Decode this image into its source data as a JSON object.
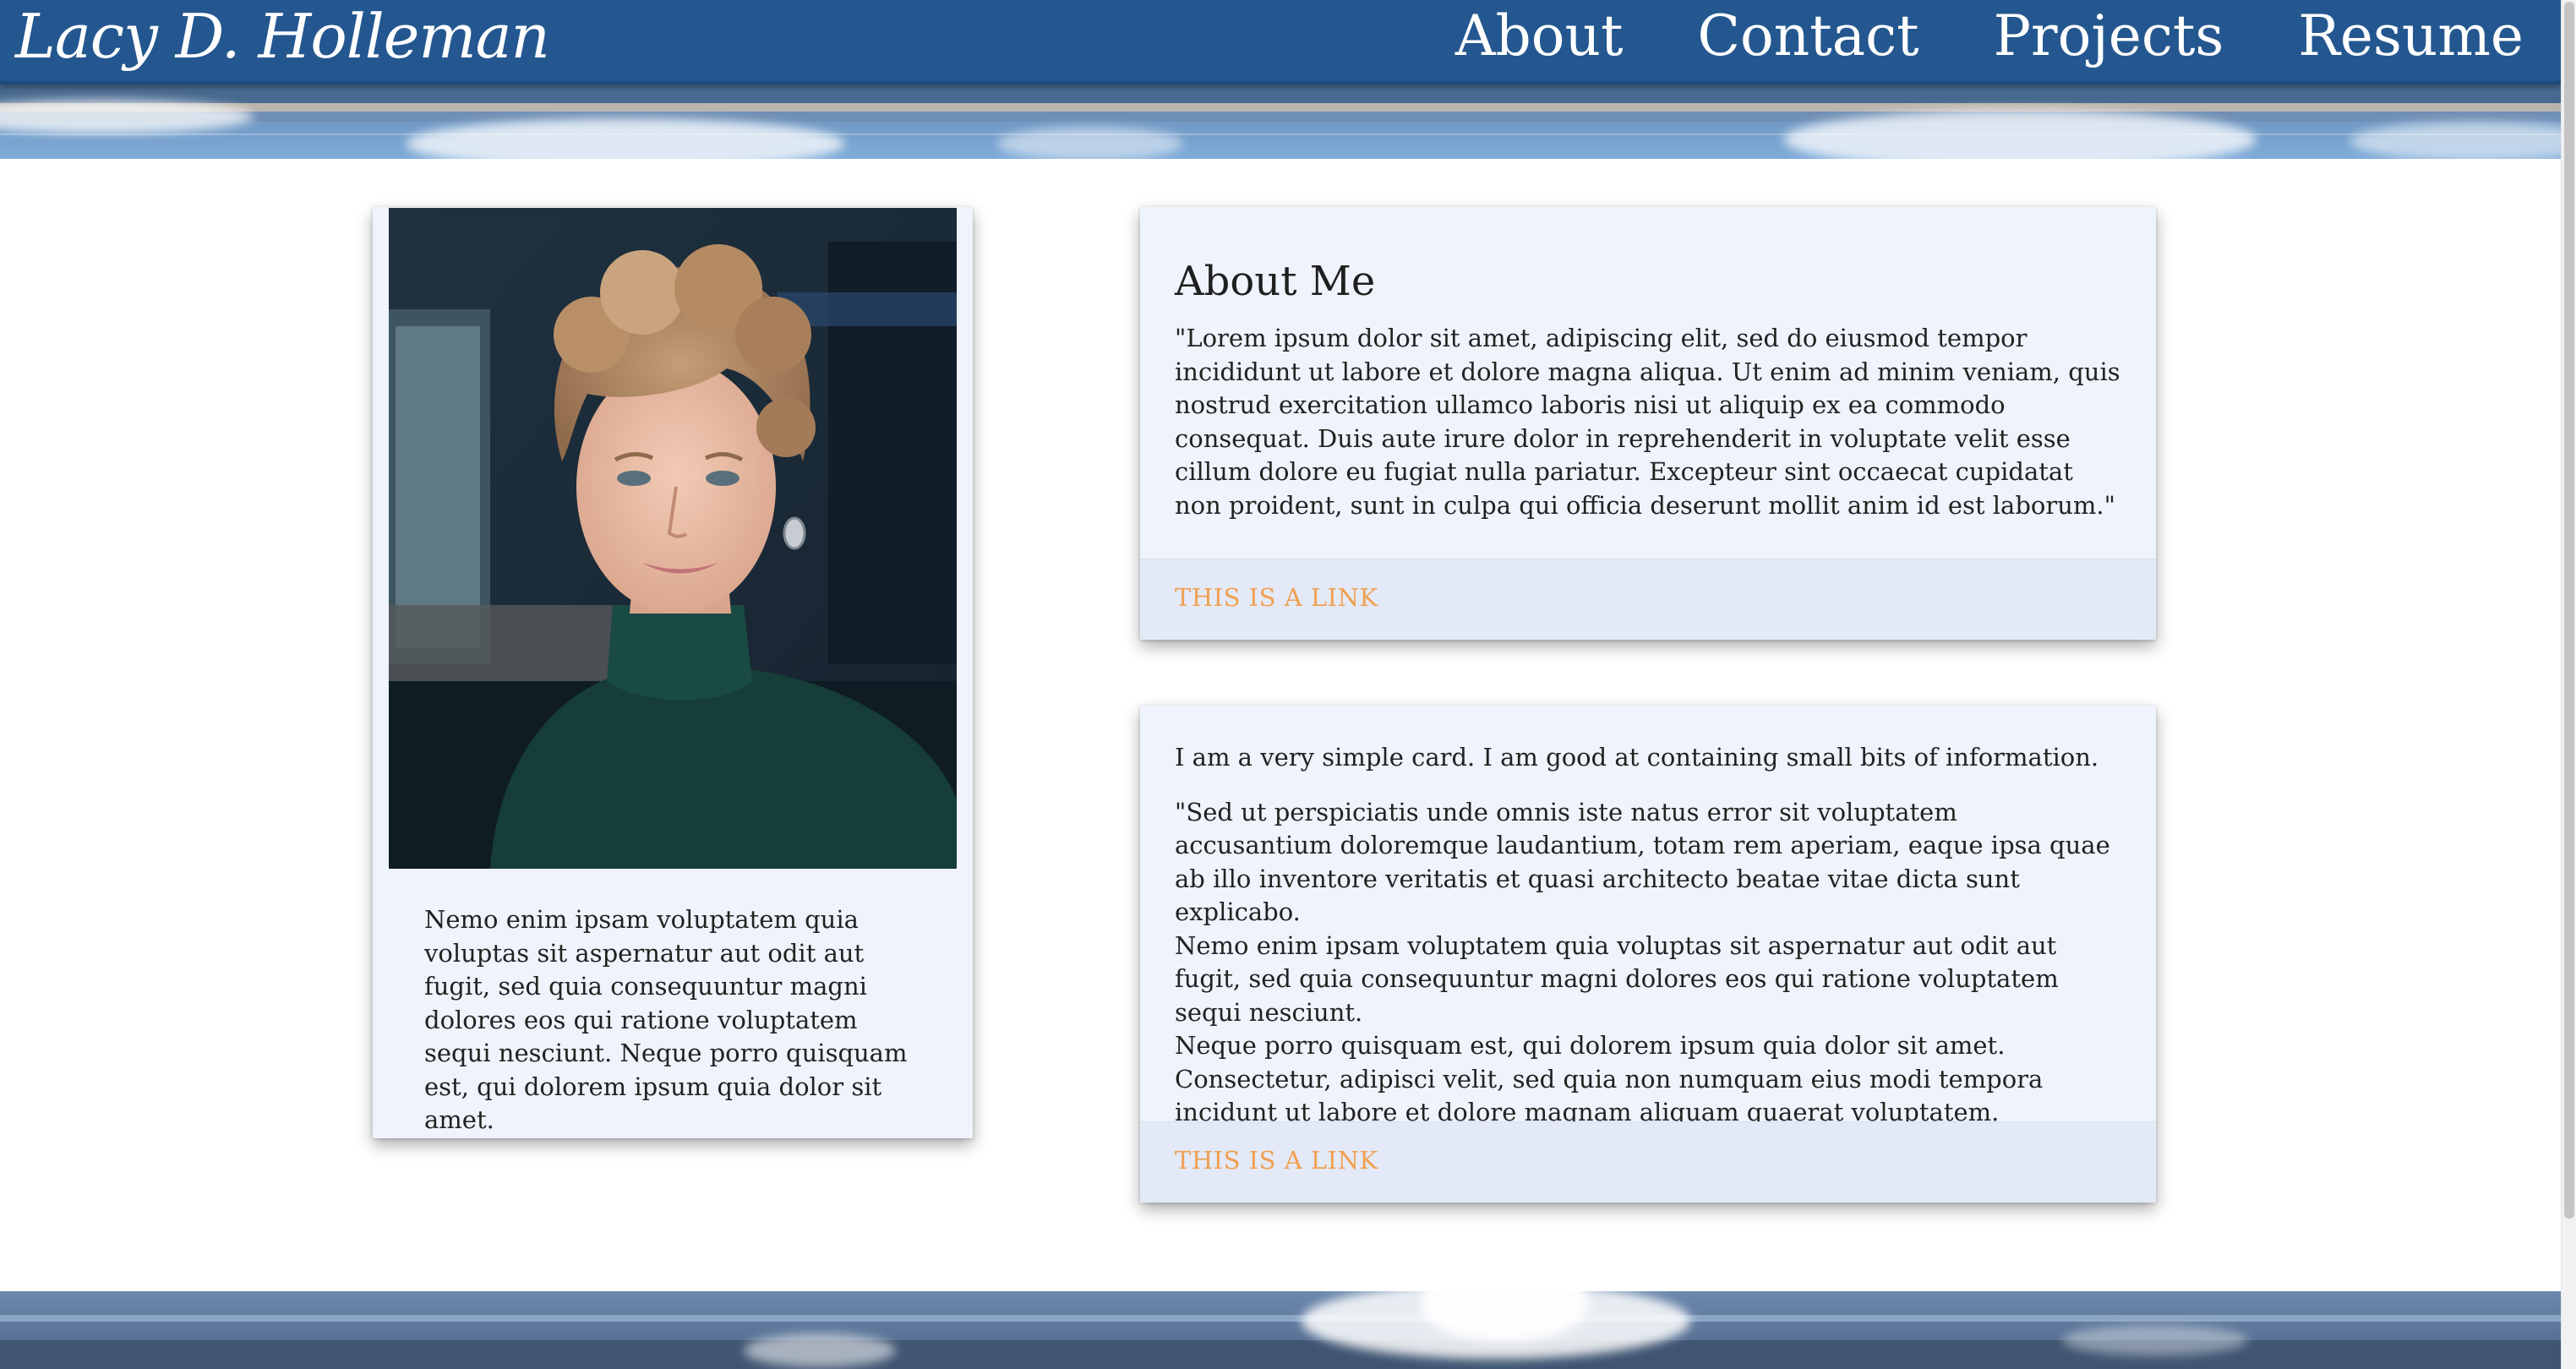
{
  "site": {
    "name": "Lacy D. Holleman"
  },
  "nav": {
    "items": [
      {
        "label": "About"
      },
      {
        "label": "Contact"
      },
      {
        "label": "Projects"
      },
      {
        "label": "Resume"
      }
    ]
  },
  "profile": {
    "text": "Nemo enim ipsam voluptatem quia voluptas sit aspernatur aut odit aut fugit, sed quia consequuntur magni dolores eos qui ratione voluptatem sequi nesciunt. Neque porro quisquam est, qui dolorem ipsum quia dolor sit amet."
  },
  "about_card": {
    "title": "About Me",
    "body": "\"Lorem ipsum dolor sit amet, adipiscing elit, sed do eiusmod tempor incididunt ut labore et dolore magna aliqua. Ut enim ad minim veniam, quis nostrud exercitation ullamco laboris nisi ut aliquip ex ea commodo consequat. Duis aute irure dolor in reprehenderit in voluptate velit esse cillum dolore eu fugiat nulla pariatur. Excepteur sint occaecat cupidatat non proident, sunt in culpa qui officia deserunt mollit anim id est laborum.\"",
    "link": "THIS IS A LINK"
  },
  "info_card": {
    "intro": "I am a very simple card. I am good at containing small bits of information.",
    "lines": [
      "\"Sed ut perspiciatis unde omnis iste natus error sit voluptatem accusantium doloremque laudantium, totam rem aperiam, eaque ipsa quae ab illo inventore veritatis et quasi architecto beatae vitae dicta sunt explicabo.",
      "Nemo enim ipsam voluptatem quia voluptas sit aspernatur aut odit aut fugit, sed quia consequuntur magni dolores eos qui ratione voluptatem sequi nesciunt.",
      "Neque porro quisquam est, qui dolorem ipsum quia dolor sit amet.",
      "Consectetur, adipisci velit, sed quia non numquam eius modi tempora incidunt ut labore et dolore magnam aliquam quaerat voluptatem."
    ],
    "link": "THIS IS A LINK"
  },
  "colors": {
    "nav_bg": "#24578f",
    "card_bg": "#eff3fb",
    "card_action_bg": "#e3e9f6",
    "link": "#f0a050"
  }
}
